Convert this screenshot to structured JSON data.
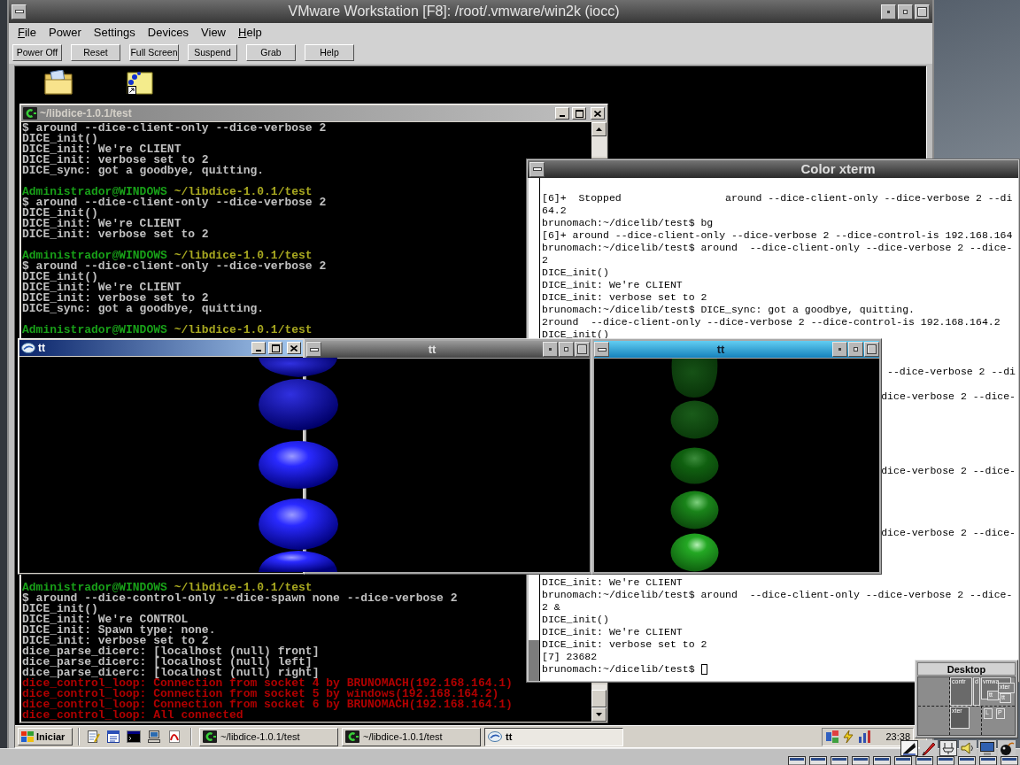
{
  "vmware_window": {
    "title": "VMware Workstation [F8]: /root/.vmware/win2k (iocc)",
    "menu": [
      {
        "label": "File",
        "mnemonic": true
      },
      {
        "label": "Power",
        "mnemonic": false
      },
      {
        "label": "Settings",
        "mnemonic": false
      },
      {
        "label": "Devices",
        "mnemonic": false
      },
      {
        "label": "View",
        "mnemonic": false
      },
      {
        "label": "Help",
        "mnemonic": true
      }
    ],
    "toolbar": [
      "Power Off",
      "Reset",
      "Full Screen",
      "Suspend",
      "Grab",
      "Help"
    ]
  },
  "cygwin_window": {
    "title": "~/libdice-1.0.1/test",
    "active": false,
    "upper_lines": [
      {
        "kind": "output",
        "text": "$ around --dice-client-only --dice-verbose 2"
      },
      {
        "kind": "output",
        "text": "DICE_init()"
      },
      {
        "kind": "output",
        "text": "DICE_init: We're CLIENT"
      },
      {
        "kind": "output",
        "text": "DICE_init: verbose set to 2"
      },
      {
        "kind": "output",
        "text": "DICE_sync: got a goodbye, quitting."
      },
      {
        "kind": "blank"
      },
      {
        "kind": "prompt",
        "user": "Administrador@WINDOWS",
        "path": "~/libdice-1.0.1/test"
      },
      {
        "kind": "output",
        "text": "$ around --dice-client-only --dice-verbose 2"
      },
      {
        "kind": "output",
        "text": "DICE_init()"
      },
      {
        "kind": "output",
        "text": "DICE_init: We're CLIENT"
      },
      {
        "kind": "output",
        "text": "DICE_init: verbose set to 2"
      },
      {
        "kind": "blank"
      },
      {
        "kind": "prompt",
        "user": "Administrador@WINDOWS",
        "path": "~/libdice-1.0.1/test"
      },
      {
        "kind": "output",
        "text": "$ around --dice-client-only --dice-verbose 2"
      },
      {
        "kind": "output",
        "text": "DICE_init()"
      },
      {
        "kind": "output",
        "text": "DICE_init: We're CLIENT"
      },
      {
        "kind": "output",
        "text": "DICE_init: verbose set to 2"
      },
      {
        "kind": "output",
        "text": "DICE_sync: got a goodbye, quitting."
      },
      {
        "kind": "blank"
      },
      {
        "kind": "prompt",
        "user": "Administrador@WINDOWS",
        "path": "~/libdice-1.0.1/test"
      }
    ],
    "lower_lines": [
      {
        "kind": "prompt",
        "user": "Administrador@WINDOWS",
        "path": "~/libdice-1.0.1/test"
      },
      {
        "kind": "output",
        "text": "$ around --dice-control-only --dice-spawn none --dice-verbose 2"
      },
      {
        "kind": "output",
        "text": "DICE_init()"
      },
      {
        "kind": "output",
        "text": "DICE_init: We're CONTROL"
      },
      {
        "kind": "output",
        "text": "DICE_init: Spawn type: none."
      },
      {
        "kind": "output",
        "text": "DICE_init: verbose set to 2"
      },
      {
        "kind": "output",
        "text": "dice_parse_dicerc: [localhost (null) front]"
      },
      {
        "kind": "output",
        "text": "dice_parse_dicerc: [localhost (null) left]"
      },
      {
        "kind": "output",
        "text": "dice_parse_dicerc: [localhost (null) right]"
      },
      {
        "kind": "error",
        "text": "dice_control_loop: Connection from socket 4 by BRUNOMACH(192.168.164.1)"
      },
      {
        "kind": "error",
        "text": "dice_control_loop: Connection from socket 5 by windows(192.168.164.2)"
      },
      {
        "kind": "error",
        "text": "dice_control_loop: Connection from socket 6 by BRUNOMACH(192.168.164.1)"
      },
      {
        "kind": "error",
        "text": "dice_control_loop: All connected"
      }
    ]
  },
  "xterm_window": {
    "title": "Color xterm",
    "lines": [
      {
        "kind": "text",
        "text": "[6]+  Stopped                 around --dice-client-only --dice-verbose 2 --di"
      },
      {
        "kind": "text",
        "text": "64.2"
      },
      {
        "kind": "text",
        "text": "brunomach:~/dicelib/test$ bg"
      },
      {
        "kind": "text",
        "text": "[6]+ around --dice-client-only --dice-verbose 2 --dice-control-is 192.168.164"
      },
      {
        "kind": "text",
        "text": "brunomach:~/dicelib/test$ around  --dice-client-only --dice-verbose 2 --dice-"
      },
      {
        "kind": "text",
        "text": "2"
      },
      {
        "kind": "text",
        "text": "DICE_init()"
      },
      {
        "kind": "text",
        "text": "DICE_init: We're CLIENT"
      },
      {
        "kind": "text",
        "text": "DICE_init: verbose set to 2"
      },
      {
        "kind": "text",
        "text": "brunomach:~/dicelib/test$ DICE_sync: got a goodbye, quitting."
      },
      {
        "kind": "text",
        "text": "2round  --dice-client-only --dice-verbose 2 --dice-control-is 192.168.164.2"
      },
      {
        "kind": "text",
        "text": "DICE_init()"
      },
      {
        "kind": "covered"
      },
      {
        "kind": "covered"
      },
      {
        "kind": "tail",
        "text": "--dice-verbose 2 --di"
      },
      {
        "kind": "covered"
      },
      {
        "kind": "tail",
        "text": "dice-verbose 2 --dice-"
      },
      {
        "kind": "covered"
      },
      {
        "kind": "covered"
      },
      {
        "kind": "covered"
      },
      {
        "kind": "covered"
      },
      {
        "kind": "covered"
      },
      {
        "kind": "tail",
        "text": "dice-verbose 2 --dice-"
      },
      {
        "kind": "covered"
      },
      {
        "kind": "covered"
      },
      {
        "kind": "covered"
      },
      {
        "kind": "covered"
      },
      {
        "kind": "tail",
        "text": "dice-verbose 2 --dice-"
      },
      {
        "kind": "covered"
      },
      {
        "kind": "covered"
      },
      {
        "kind": "covered"
      },
      {
        "kind": "text",
        "text": "DICE_init: We're CLIENT"
      },
      {
        "kind": "text",
        "text": "brunomach:~/dicelib/test$ around  --dice-client-only --dice-verbose 2 --dice-"
      },
      {
        "kind": "text",
        "text": "2 &"
      },
      {
        "kind": "text",
        "text": "DICE_init()"
      },
      {
        "kind": "text",
        "text": "DICE_init: We're CLIENT"
      },
      {
        "kind": "text",
        "text": "DICE_init: verbose set to 2"
      },
      {
        "kind": "text",
        "text": "[7] 23682"
      },
      {
        "kind": "cursor",
        "text": "brunomach:~/dicelib/test$"
      }
    ]
  },
  "tt_windows": [
    {
      "kind": "windows",
      "title": "tt",
      "active": true
    },
    {
      "kind": "x11",
      "title": "tt",
      "active": false
    },
    {
      "kind": "x11",
      "title": "tt",
      "active": true
    }
  ],
  "guest_taskbar": {
    "start_label": "Iniciar",
    "tasks": [
      {
        "kind": "terminal",
        "label": "~/libdice-1.0.1/test",
        "selected": false
      },
      {
        "kind": "terminal",
        "label": "~/libdice-1.0.1/test",
        "selected": false
      },
      {
        "kind": "window",
        "label": "tt",
        "selected": true
      }
    ],
    "clock": "23:38"
  },
  "pager": {
    "title": "Desktop",
    "windows": [
      "contr",
      "d",
      "vmwa",
      "xter",
      "tt",
      "tt",
      "xter",
      "L",
      "P"
    ]
  }
}
